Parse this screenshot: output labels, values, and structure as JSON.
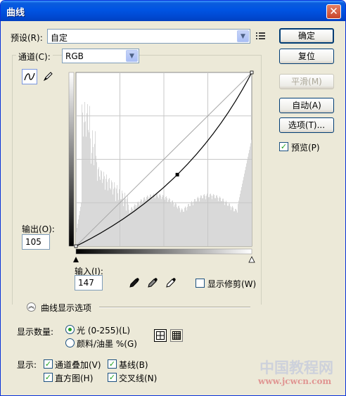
{
  "window": {
    "title": "曲线",
    "close_glyph": "✕"
  },
  "preset": {
    "label": "预设(R):",
    "value": "自定"
  },
  "channel": {
    "label": "通道(C):",
    "value": "RGB"
  },
  "buttons": {
    "ok": "确定",
    "reset": "复位",
    "smooth": "平滑(M)",
    "auto": "自动(A)",
    "options": "选项(T)..."
  },
  "preview": {
    "label": "预览(P)",
    "checked": true
  },
  "output": {
    "label": "输出(O):",
    "value": "105"
  },
  "input": {
    "label": "输入(I):",
    "value": "147"
  },
  "show_clipping": {
    "label": "显示修剪(W)",
    "checked": false
  },
  "curve_options": {
    "label": "曲线显示选项"
  },
  "show_amount": {
    "label": "显示数量:",
    "light": "光 (0-255)(L)",
    "pigment": "颜料/油墨 %(G)",
    "selected": "light"
  },
  "show": {
    "label": "显示:",
    "channel_overlays": "通道叠加(V)",
    "baseline": "基线(B)",
    "histogram": "直方图(H)",
    "intersection_line": "交叉线(N)"
  },
  "curve_point": {
    "input": 147,
    "output": 105
  },
  "watermark": {
    "text1": "中国教程网",
    "text2": "www.jcwcn.com"
  },
  "colors": {
    "accent": "#0054e3",
    "check": "#21a121",
    "dialog": "#ece9d8"
  },
  "icons": {
    "curve_tool": "curve-tool-icon",
    "pencil_tool": "pencil-tool-icon",
    "black_eyedropper": "eyedropper-black-icon",
    "gray_eyedropper": "eyedropper-gray-icon",
    "white_eyedropper": "eyedropper-white-icon",
    "preset_menu": "preset-menu-icon",
    "collapse": "collapse-chevron-icon",
    "simple_grid": "simple-grid-icon",
    "detailed_grid": "detailed-grid-icon"
  }
}
